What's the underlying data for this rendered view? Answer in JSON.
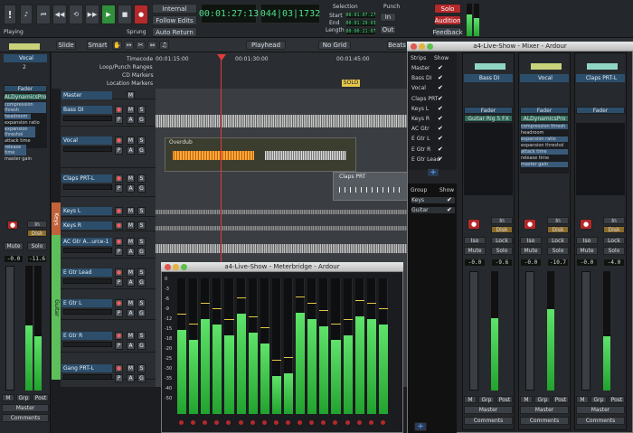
{
  "transport": {
    "status_left": "Playing",
    "status_right": "Sprung",
    "internal": "Internal",
    "follow_edits": "Follow Edits",
    "auto_return": "Auto Return",
    "clock1": "00:01:27:13",
    "clock2": "044|03|1732",
    "clock1_sub": "",
    "selection_title": "Selection",
    "start_label": "Start",
    "end_label": "End",
    "length_label": "Length",
    "start_val": "00:01:07:27",
    "end_val": "00:01:29:03",
    "length_val": "00:00:21:07",
    "punch_title": "Punch",
    "in_label": "In",
    "out_label": "Out",
    "solo": "Solo",
    "audition": "Audition",
    "feedback": "Feedback"
  },
  "toolbar": {
    "slide": "Slide",
    "smart": "Smart",
    "playhead": "Playhead",
    "no_grid": "No Grid",
    "beats": "Beats"
  },
  "rulers": {
    "timecode": "Timecode",
    "loop_punch": "Loop/Punch Ranges",
    "cd_markers": "CD Markers",
    "location_markers": "Location Markers",
    "t1": "00:01:15:00",
    "t2": "00:01:30:00",
    "t3": "00:01:45:00",
    "solo_marker": "SOLO"
  },
  "left_strip": {
    "name": "Vocal",
    "input": "2",
    "fader_label": "Fader",
    "plugin": "ALDynamicsPro",
    "params": [
      "compression thresh",
      "headroom",
      "expansion ratio",
      "expansion threshol",
      "attack time",
      "release time",
      "master gain"
    ],
    "in": "In",
    "disk": "Disk",
    "mute": "Mute",
    "solo": "Solo",
    "gain1": "-0.0",
    "gain2": "-11.6",
    "m": "M",
    "grp": "Grp",
    "post": "Post",
    "master": "Master",
    "comments": "Comments"
  },
  "tracks": [
    {
      "name": "Master"
    },
    {
      "name": "Bass DI"
    },
    {
      "name": "Vocal"
    },
    {
      "name": "Claps PRT-L"
    },
    {
      "name": "Keys L"
    },
    {
      "name": "Keys R"
    },
    {
      "name": "AC Gtr A...urce-1"
    },
    {
      "name": "E Gtr Lead"
    },
    {
      "name": "E Gtr L"
    },
    {
      "name": "E Gtr R"
    },
    {
      "name": "Gang PRT-L"
    }
  ],
  "group_tabs": {
    "keys": "Keys",
    "guitar": "Guitar"
  },
  "region_labels": {
    "overdub": "Overdub",
    "claps": "Claps PRT"
  },
  "meterbridge": {
    "title": "a4-Live-Show - Meterbridge - Ardour",
    "scale": [
      "0",
      "-3",
      "-6",
      "-9",
      "-12",
      "-15",
      "-18",
      "-20",
      "-25",
      "-30",
      "-35",
      "-40",
      "-50"
    ],
    "levels": [
      0.62,
      0.55,
      0.7,
      0.66,
      0.58,
      0.74,
      0.6,
      0.52,
      0.28,
      0.3,
      0.75,
      0.7,
      0.65,
      0.55,
      0.58,
      0.72,
      0.7,
      0.66
    ]
  },
  "mixer": {
    "title": "a4-Live-Show - Mixer - Ardour",
    "strips_header": "Strips",
    "show_header": "Show",
    "strips": [
      "Master",
      "Bass DI",
      "Vocal",
      "Claps PRT",
      "Keys L",
      "Keys R",
      "AC Gtr",
      "E Gtr L",
      "E Gtr R",
      "E Gtr Lead"
    ],
    "group_header": "Group",
    "group_show": "Show",
    "groups": [
      "Keys",
      "Guitar"
    ],
    "channels": [
      {
        "name": "Bass DI",
        "fader": "Fader",
        "plugin": "Guitar Rig 5 FX",
        "gain1": "-0.0",
        "gain2": "-9.6"
      },
      {
        "name": "Vocal",
        "fader": "Fader",
        "plugin": "ALDynamicsPro",
        "gain1": "-0.0",
        "gain2": "-10.7"
      },
      {
        "name": "Claps PRT-L",
        "fader": "Fader",
        "plugin": "",
        "gain1": "-0.0",
        "gain2": "-4.0"
      }
    ],
    "params": [
      "compression thresh",
      "headroom",
      "expansion ratio",
      "expansion threshol",
      "attack time",
      "release time",
      "master gain"
    ],
    "in": "In",
    "disk": "Disk",
    "iso": "Iso",
    "lock": "Lock",
    "mute": "Mute",
    "solo": "Solo",
    "m": "M",
    "grp": "Grp",
    "post": "Post",
    "master": "Master",
    "comments": "Comments"
  },
  "colors": {
    "accent_green": "#2f8f3b",
    "record_red": "#b5292b",
    "track_blue": "#2c4e6b",
    "lcd_green": "#4fe08a"
  }
}
